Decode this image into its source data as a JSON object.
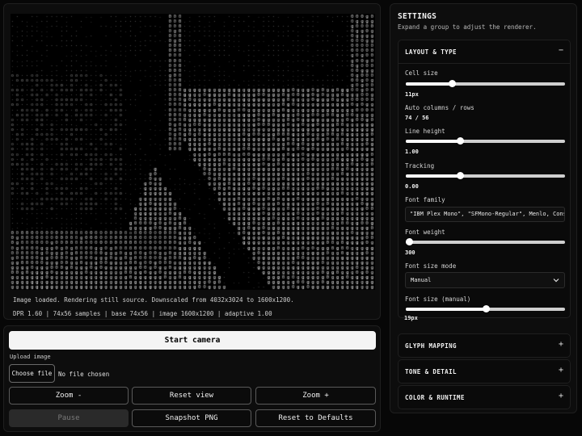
{
  "stage": {
    "status": "Image loaded. Rendering still source. Downscaled from 4032x3024 to 1600x1200.",
    "metrics": "DPR 1.60 | 74x56 samples | base 74x56 | image 1600x1200 | adaptive 1.00"
  },
  "controls": {
    "start_camera": "Start camera",
    "upload_label": "Upload image",
    "choose_file": "Choose file",
    "file_status": "No file chosen",
    "zoom_out": "Zoom -",
    "reset_view": "Reset view",
    "zoom_in": "Zoom +",
    "pause": "Pause",
    "snapshot": "Snapshot PNG",
    "reset_defaults": "Reset to Defaults"
  },
  "settings": {
    "title": "SETTINGS",
    "subtitle": "Expand a group to adjust the renderer.",
    "layout": {
      "title": "LAYOUT & TYPE",
      "toggle": "−",
      "cell_size_label": "Cell size",
      "cell_size_value": "11px",
      "cell_size_pos": 0.29,
      "auto_label": "Auto columns / rows",
      "auto_value": "74 / 56",
      "line_height_label": "Line height",
      "line_height_value": "1.00",
      "line_height_pos": 0.34,
      "tracking_label": "Tracking",
      "tracking_value": "0.00",
      "tracking_pos": 0.34,
      "font_family_label": "Font family",
      "font_family_value": "\"IBM Plex Mono\", \"SFMono-Regular\", Menlo, Consolas,",
      "font_weight_label": "Font weight",
      "font_weight_value": "300",
      "font_weight_pos": 0.02,
      "font_size_mode_label": "Font size mode",
      "font_size_mode_value": "Manual",
      "font_size_label": "Font size (manual)",
      "font_size_value": "19px",
      "font_size_pos": 0.5
    },
    "glyph": {
      "title": "GLYPH MAPPING",
      "toggle": "+"
    },
    "tone": {
      "title": "TONE & DETAIL",
      "toggle": "+"
    },
    "color": {
      "title": "COLOR & RUNTIME",
      "toggle": "+"
    }
  }
}
